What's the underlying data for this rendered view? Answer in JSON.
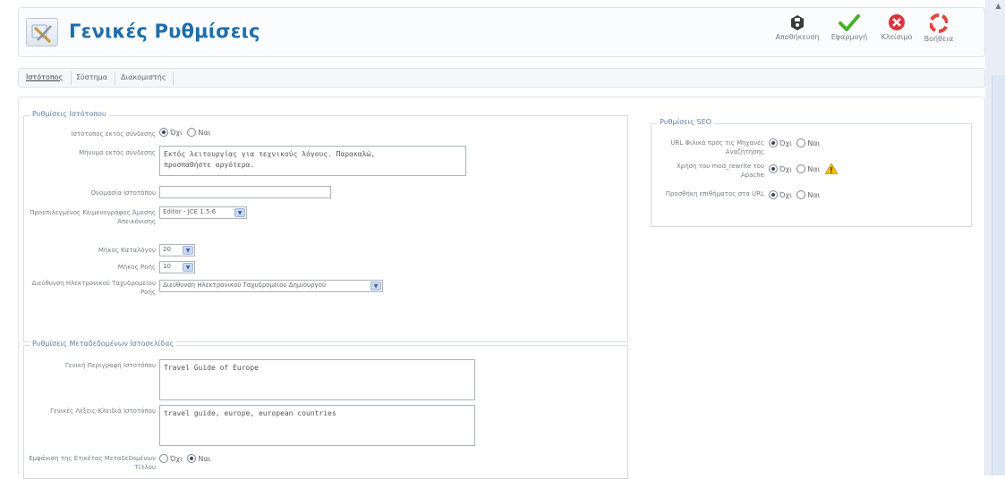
{
  "page": {
    "title": "Γενικές Ρυθμίσεις"
  },
  "toolbar": {
    "save": "Αποθήκευση",
    "apply": "Εφαρμογή",
    "close": "Κλείσιμο",
    "help": "Βοήθεια"
  },
  "tabs": [
    "Ιστότοπος",
    "Σύστημα",
    "Διακομιστής"
  ],
  "site_settings": {
    "legend": "Ρυθμίσεις Ιστότοπου",
    "offline_label": "Ιστότοπος εκτός σύνδεσης",
    "offline_options": [
      "Όχι",
      "Ναι"
    ],
    "offline_value": "Όχι",
    "offline_msg_label": "Μήνυμα εκτός σύνδεσης",
    "offline_msg_value": "Εκτός λειτουργίας για τεχνικούς λόγους. Παρακαλώ,\nπροσπαθήστε αργότερα.",
    "site_name_label": "Ονομασία Ιστοτόπου",
    "site_name_value": "",
    "editor_label": "Προεπιλεγμένος Κειμενογράφος Άμεσης Απεικόνισης",
    "editor_value": "Editor - JCE 1.5.6",
    "list_length_label": "Μήκος Καταλόγου",
    "list_length_value": "20",
    "feed_length_label": "Μήκος Ροής",
    "feed_length_value": "10",
    "feed_email_label": "Διεύθυνση Ηλεκτρονικού Ταχυδρομείου Ροής",
    "feed_email_value": "Διεύθυνση Ηλεκτρονικού Ταχυδρομείου Δημιουργού"
  },
  "metadata": {
    "legend": "Ρυθμίσεις Μεταδεδομένων Ιστοσελίδας",
    "description_label": "Γενική Περιγραφή Ιστοτόπου",
    "description_value": "Travel Guide of Europe",
    "keywords_label": "Γενικές Λέξεις-Κλειδιά Ιστοτόπου",
    "keywords_value": "travel guide, europe, european countries",
    "show_title_label": "Εμφάνιση της Ετικέτας Μεταδεδομένων Τίτλου",
    "show_title_options": [
      "Όχι",
      "Ναι"
    ],
    "show_title_value": "Ναι"
  },
  "seo": {
    "legend": "Ρυθμίσεις SEO",
    "sef_urls_label": "URL Φιλικά προς τις Μηχανές Αναζήτησης",
    "sef_urls_options": [
      "Όχι",
      "Ναι"
    ],
    "sef_urls_value": "Όχι",
    "rewrite_label": "Χρήση του mod_rewrite του Apache",
    "rewrite_options": [
      "Όχι",
      "Ναι"
    ],
    "rewrite_value": "Όχι",
    "suffix_label": "Προσθήκη επιθήματος στα URL",
    "suffix_options": [
      "Όχι",
      "Ναι"
    ],
    "suffix_value": "Όχι"
  },
  "colors": {
    "title": "#1f6dab",
    "legend": "#5d7fa5",
    "save_icon": "#3b3b3b",
    "apply_icon": "#4caf2a",
    "close_icon": "#d9343a",
    "help_icon": "#e0463d",
    "warning_icon": "#f2c200"
  },
  "icons": {
    "header": "config-tools-icon",
    "save": "save-disk-icon",
    "apply": "checkmark-icon",
    "close": "close-circle-icon",
    "help": "lifebuoy-icon",
    "warning": "warning-triangle-icon"
  }
}
